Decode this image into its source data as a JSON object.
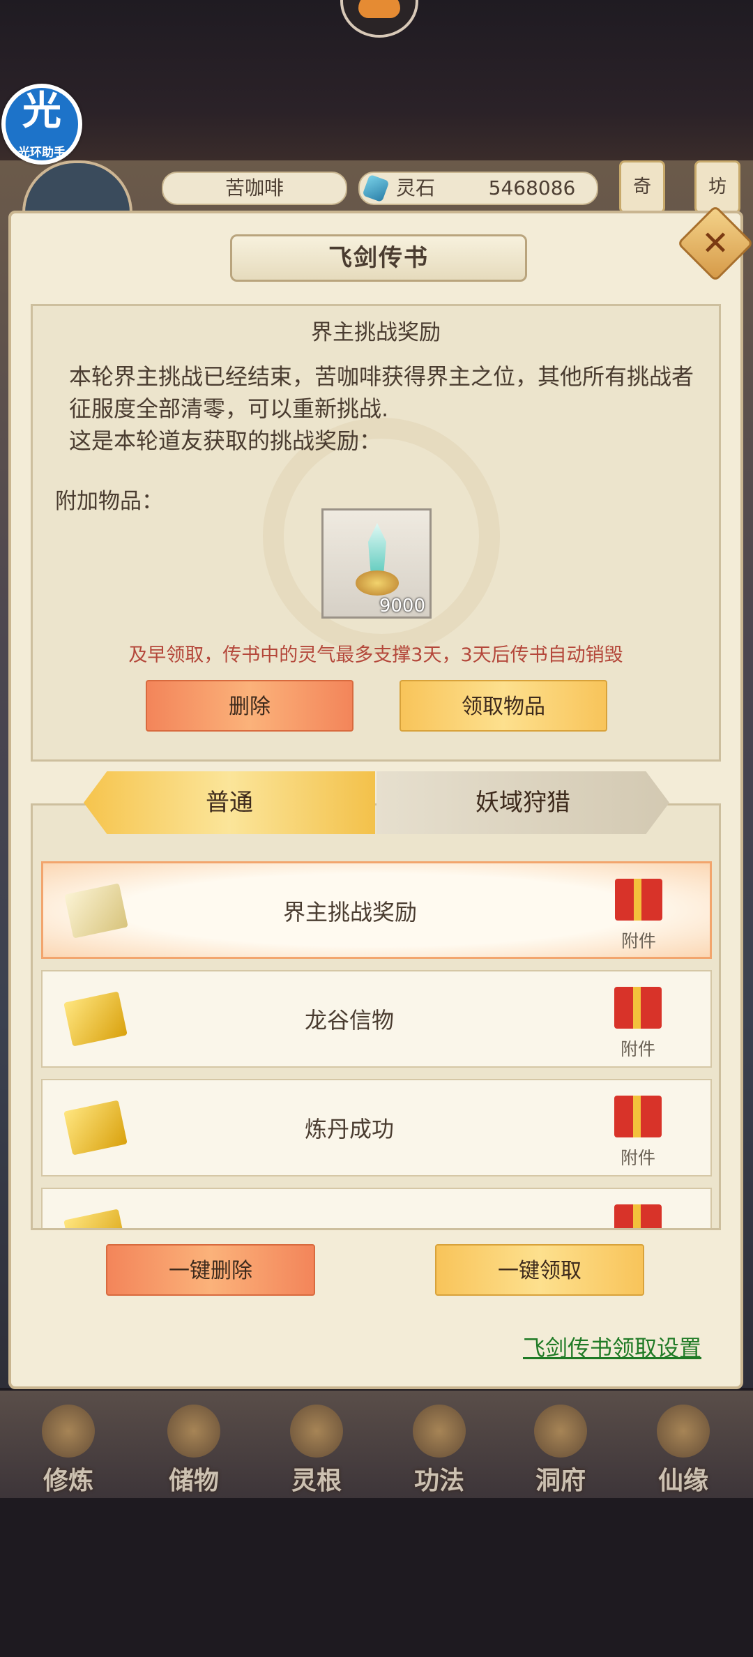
{
  "hud": {
    "player_name": "苦咖啡",
    "resource_label": "灵石",
    "resource_value": "5468086",
    "side_tags": [
      "奇",
      "坊"
    ]
  },
  "assistant": {
    "glyph": "光",
    "caption": "光环助手"
  },
  "panel": {
    "title": "飞剑传书",
    "close_glyph": "✕",
    "mail": {
      "subject": "界主挑战奖励",
      "body_line1": "本轮界主挑战已经结束，苦咖啡获得界主之位，其他所有挑战者征服度全部清零，可以重新挑战.",
      "body_line2": "这是本轮道友获取的挑战奖励：",
      "attachments_label": "附加物品：",
      "item_count": "9000",
      "warning": "及早领取，传书中的灵气最多支撑3天，3天后传书自动销毁",
      "delete_label": "删除",
      "claim_label": "领取物品"
    },
    "tabs": [
      {
        "label": "普通",
        "active": true
      },
      {
        "label": "妖域狩猎",
        "active": false
      }
    ],
    "list": [
      {
        "title": "界主挑战奖励",
        "attach": "附件",
        "selected": true,
        "opened": true
      },
      {
        "title": "龙谷信物",
        "attach": "附件",
        "selected": false,
        "opened": false
      },
      {
        "title": "炼丹成功",
        "attach": "附件",
        "selected": false,
        "opened": false
      }
    ],
    "delete_all_label": "一键删除",
    "claim_all_label": "一键领取",
    "settings_link": "飞剑传书领取设置"
  },
  "bottom_nav": [
    "修炼",
    "储物",
    "灵根",
    "功法",
    "洞府",
    "仙缘"
  ],
  "colors": {
    "warning": "#b4473a",
    "link": "#1f7a25",
    "assistant": "#1d73c9"
  }
}
